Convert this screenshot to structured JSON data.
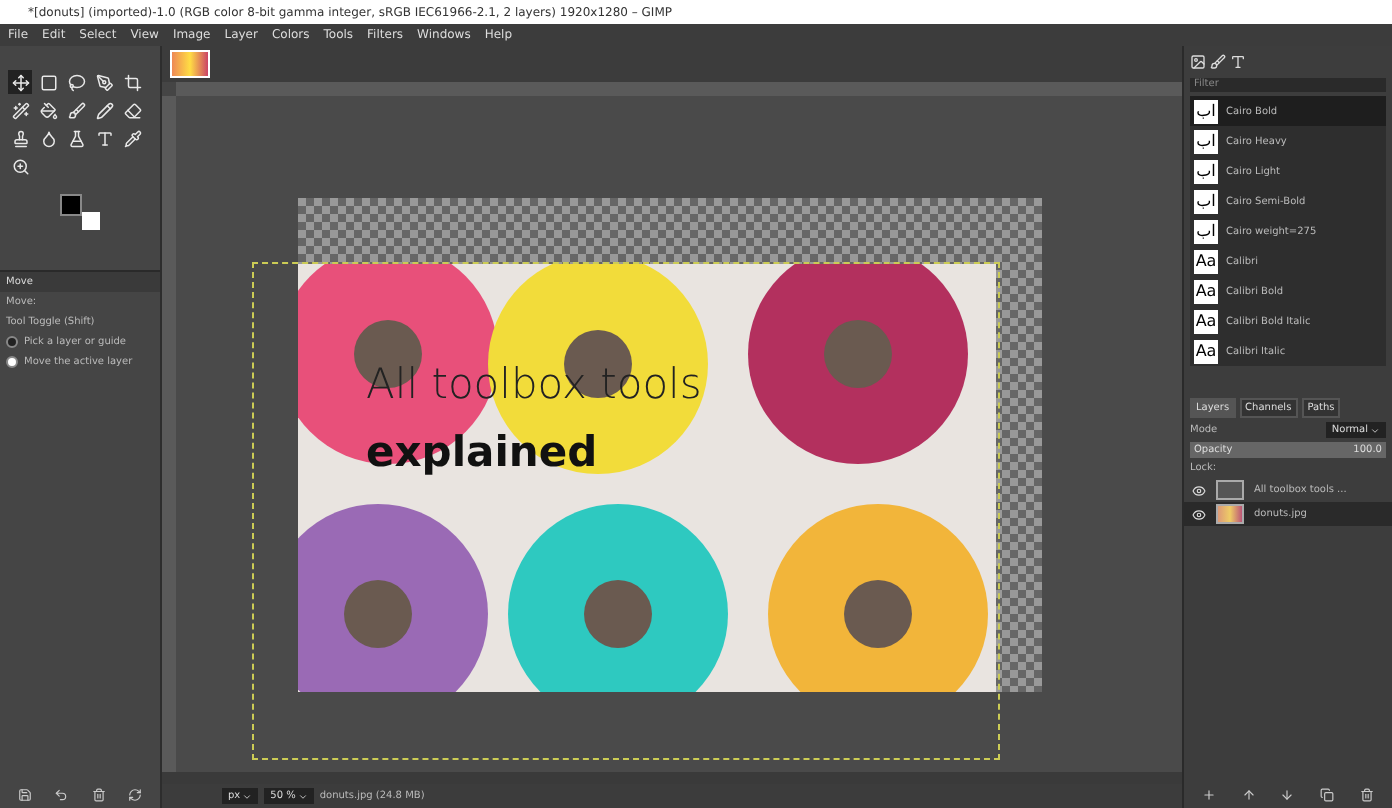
{
  "window": {
    "title": "*[donuts] (imported)-1.0 (RGB color 8-bit gamma integer, sRGB IEC61966-2.1, 2 layers) 1920x1280 – GIMP"
  },
  "menu": [
    "File",
    "Edit",
    "Select",
    "View",
    "Image",
    "Layer",
    "Colors",
    "Tools",
    "Filters",
    "Windows",
    "Help"
  ],
  "tools": [
    {
      "kind": "move",
      "selected": true
    },
    {
      "kind": "rect",
      "selected": false
    },
    {
      "kind": "lasso",
      "selected": false
    },
    {
      "kind": "pen",
      "selected": false
    },
    {
      "kind": "crop",
      "selected": false
    },
    {
      "kind": "wand",
      "selected": false
    },
    {
      "kind": "bucket",
      "selected": false
    },
    {
      "kind": "brush",
      "selected": false
    },
    {
      "kind": "pencil",
      "selected": false
    },
    {
      "kind": "eraser",
      "selected": false
    },
    {
      "kind": "stamp",
      "selected": false
    },
    {
      "kind": "drop",
      "selected": false
    },
    {
      "kind": "flask",
      "selected": false
    },
    {
      "kind": "text",
      "selected": false
    },
    {
      "kind": "picker",
      "selected": false
    },
    {
      "kind": "zoom",
      "selected": false
    }
  ],
  "tool_options": {
    "title": "Move",
    "move_label": "Move:",
    "toggle": "Tool Toggle  (Shift)",
    "options": [
      {
        "label": "Pick a layer or guide",
        "selected": false
      },
      {
        "label": "Move the active layer",
        "selected": true
      }
    ]
  },
  "canvas": {
    "headline": "All toolbox tools",
    "subline": "explained"
  },
  "fonts": {
    "filter": "Filter",
    "items": [
      {
        "preview": "اب",
        "name": "Cairo Bold",
        "selected": true
      },
      {
        "preview": "اب",
        "name": "Cairo Heavy",
        "selected": false
      },
      {
        "preview": "اب",
        "name": "Cairo Light",
        "selected": false
      },
      {
        "preview": "اب",
        "name": "Cairo Semi-Bold",
        "selected": false
      },
      {
        "preview": "اب",
        "name": "Cairo weight=275",
        "selected": false
      },
      {
        "preview": "Aa",
        "name": "Calibri",
        "selected": false
      },
      {
        "preview": "Aa",
        "name": "Calibri Bold",
        "selected": false
      },
      {
        "preview": "Aa",
        "name": "Calibri Bold Italic",
        "selected": false
      },
      {
        "preview": "Aa",
        "name": "Calibri Italic",
        "selected": false
      }
    ]
  },
  "layers_panel": {
    "tabs": [
      {
        "label": "Layers",
        "selected": true
      },
      {
        "label": "Channels",
        "selected": false
      },
      {
        "label": "Paths",
        "selected": false
      }
    ],
    "mode_label": "Mode",
    "mode": "Normal",
    "opacity": {
      "label": "Opacity",
      "reading": "100.0",
      "level": 1
    },
    "lock_label": "Lock:",
    "layers": [
      {
        "kind": "text",
        "name": "All toolbox tools ...",
        "visible": true,
        "selected": false
      },
      {
        "kind": "image",
        "name": "donuts.jpg",
        "visible": true,
        "selected": true
      }
    ]
  },
  "status_bar": {
    "unit": "px",
    "zoom": "50 %",
    "file": "donuts.jpg (24.8 MB)"
  }
}
